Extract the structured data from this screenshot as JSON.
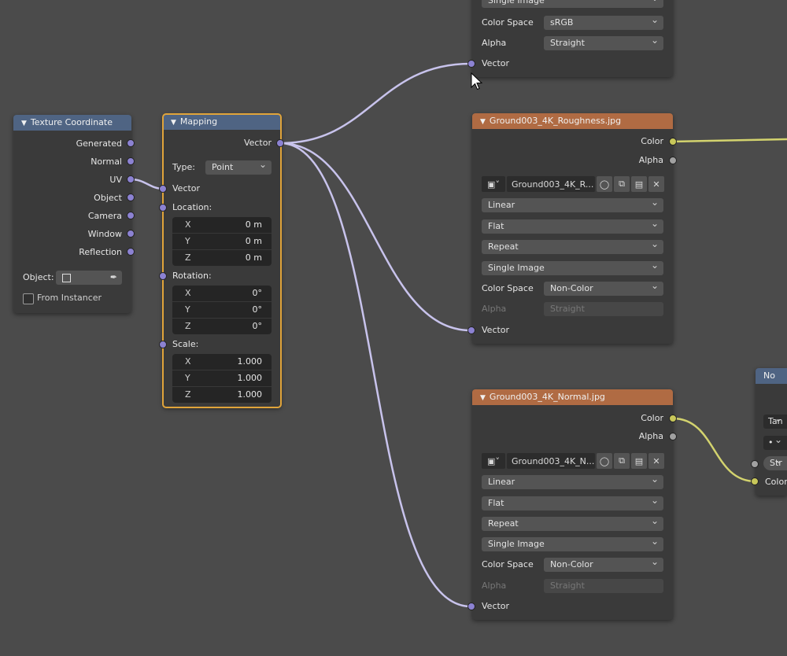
{
  "texture_coordinate": {
    "title": "Texture Coordinate",
    "outputs": [
      "Generated",
      "Normal",
      "UV",
      "Object",
      "Camera",
      "Window",
      "Reflection"
    ],
    "object_label": "Object:",
    "from_instancer_label": "From Instancer",
    "from_instancer_checked": false
  },
  "mapping": {
    "title": "Mapping",
    "output": "Vector",
    "type_label": "Type:",
    "type_value": "Point",
    "vector_input": "Vector",
    "location_label": "Location:",
    "location": [
      {
        "axis": "X",
        "value": "0 m"
      },
      {
        "axis": "Y",
        "value": "0 m"
      },
      {
        "axis": "Z",
        "value": "0 m"
      }
    ],
    "rotation_label": "Rotation:",
    "rotation": [
      {
        "axis": "X",
        "value": "0°"
      },
      {
        "axis": "Y",
        "value": "0°"
      },
      {
        "axis": "Z",
        "value": "0°"
      }
    ],
    "scale_label": "Scale:",
    "scale": [
      {
        "axis": "X",
        "value": "1.000"
      },
      {
        "axis": "Y",
        "value": "1.000"
      },
      {
        "axis": "Z",
        "value": "1.000"
      }
    ]
  },
  "top_image_node": {
    "projection_value": "Single Image",
    "color_space_label": "Color Space",
    "color_space_value": "sRGB",
    "alpha_label": "Alpha",
    "alpha_value": "Straight",
    "vector_input": "Vector"
  },
  "roughness_node": {
    "title": "Ground003_4K_Roughness.jpg",
    "out_color": "Color",
    "out_alpha": "Alpha",
    "image_name": "Ground003_4K_R...",
    "interpolation": "Linear",
    "projection": "Flat",
    "extension": "Repeat",
    "source": "Single Image",
    "color_space_label": "Color Space",
    "color_space_value": "Non-Color",
    "alpha_label": "Alpha",
    "alpha_value": "Straight",
    "vector_input": "Vector"
  },
  "normal_node": {
    "title": "Ground003_4K_Normal.jpg",
    "out_color": "Color",
    "out_alpha": "Alpha",
    "image_name": "Ground003_4K_N...",
    "interpolation": "Linear",
    "projection": "Flat",
    "extension": "Repeat",
    "source": "Single Image",
    "color_space_label": "Color Space",
    "color_space_value": "Non-Color",
    "alpha_label": "Alpha",
    "alpha_value": "Straight",
    "vector_input": "Vector"
  },
  "normal_map_node": {
    "title": "No",
    "space_value": "Tan",
    "uv_value": "•",
    "strength_label": "Str",
    "color_input": "Color"
  },
  "colors": {
    "background": "#4b4b4b",
    "node_body": "#3a3a3a",
    "input_header": "#4f6483",
    "texture_header": "#b06b43",
    "vector_socket": "#8c82d2",
    "color_socket": "#c8c75a",
    "selected_outline": "#e0a43a"
  }
}
